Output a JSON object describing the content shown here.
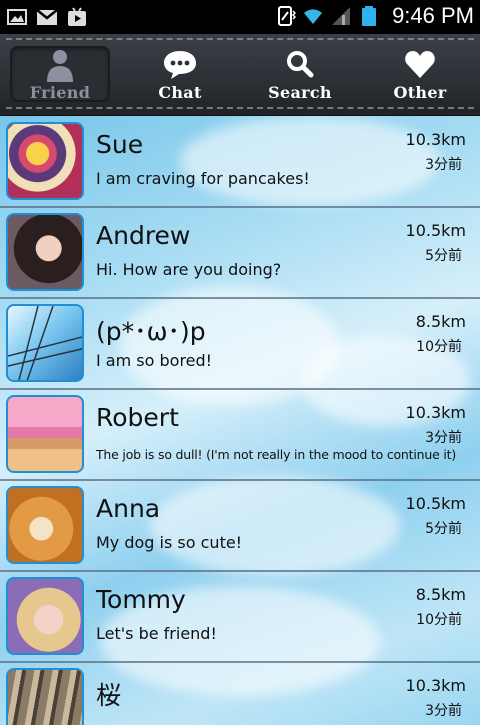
{
  "status_bar": {
    "time": "9:46 PM",
    "left_icons": [
      "image-icon",
      "gmail-icon",
      "play-store-icon"
    ],
    "right_icons": [
      "vibrate-icon",
      "wifi-icon",
      "signal-icon",
      "battery-icon"
    ]
  },
  "tabs": [
    {
      "label": "Friend",
      "icon": "person-icon",
      "active": true
    },
    {
      "label": "Chat",
      "icon": "chat-bubble-icon",
      "active": false
    },
    {
      "label": "Search",
      "icon": "search-icon",
      "active": false
    },
    {
      "label": "Other",
      "icon": "heart-icon",
      "active": false
    }
  ],
  "friends": [
    {
      "name": "Sue",
      "message": "I am craving for pancakes!",
      "distance": "10.3km",
      "time": "3分前",
      "avatar": "pancake-cake-photo"
    },
    {
      "name": "Andrew",
      "message": "Hi. How are you doing?",
      "distance": "10.5km",
      "time": "5分前",
      "avatar": "girl-portrait-photo"
    },
    {
      "name": "(p*･ω･)p",
      "message": "I am so bored!",
      "distance": "8.5km",
      "time": "10分前",
      "avatar": "sky-powerline-photo"
    },
    {
      "name": "Robert",
      "message": "The job is so dull! (I'm not really in the mood to continue it)",
      "distance": "10.3km",
      "time": "3分前",
      "avatar": "pink-pancakes-photo"
    },
    {
      "name": "Anna",
      "message": "My dog is so cute!",
      "distance": "10.5km",
      "time": "5分前",
      "avatar": "puppy-photo"
    },
    {
      "name": "Tommy",
      "message": "Let's be friend!",
      "distance": "8.5km",
      "time": "10分前",
      "avatar": "blonde-girl-photo"
    },
    {
      "name": "桜",
      "message": "",
      "distance": "10.3km",
      "time": "3分前",
      "avatar": "cat-photo"
    }
  ]
}
